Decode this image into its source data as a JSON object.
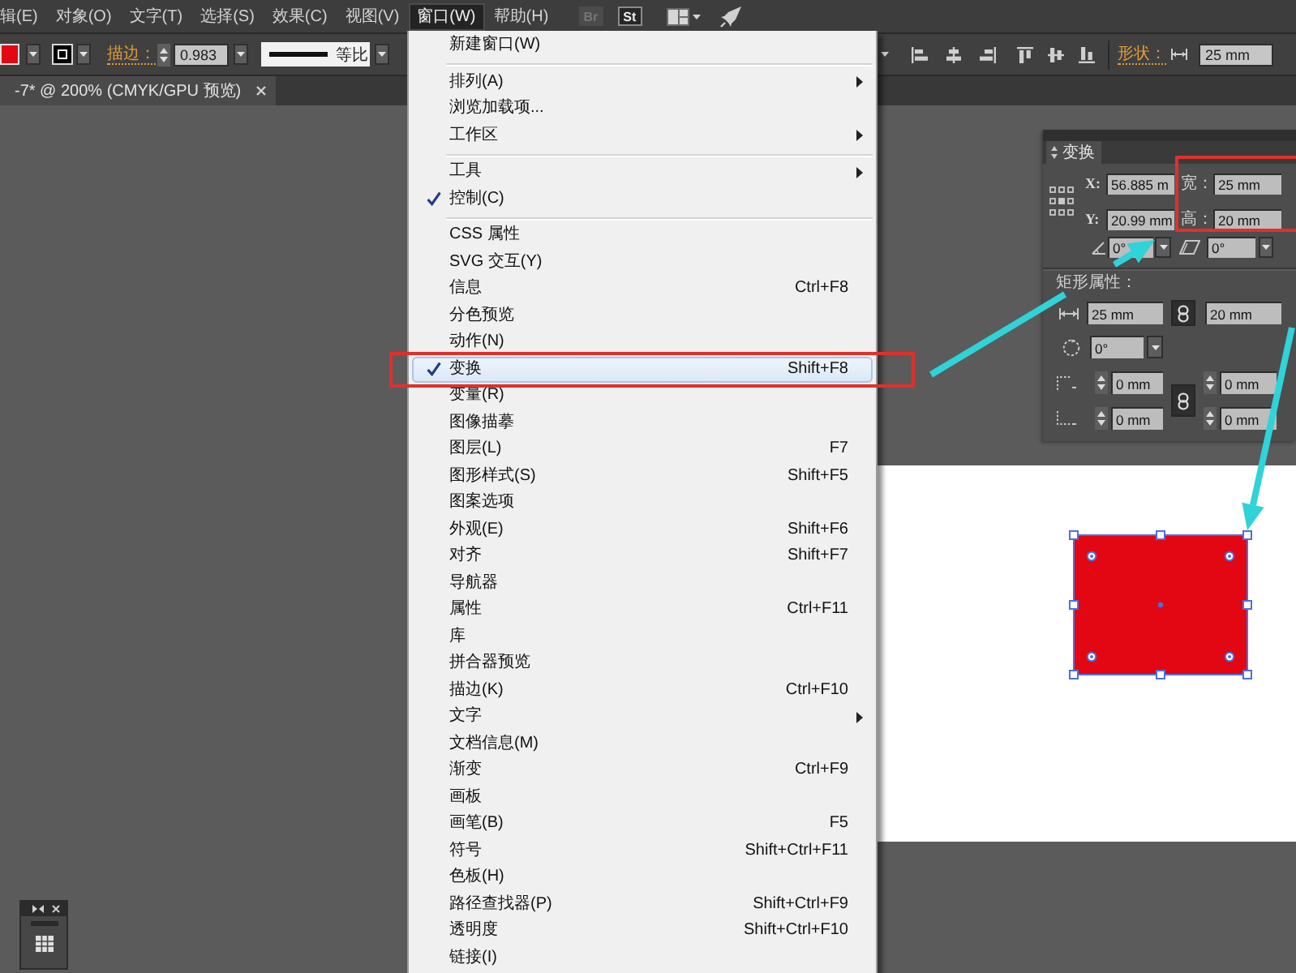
{
  "menubar": {
    "items": [
      {
        "label": "辑(E)",
        "selected": false
      },
      {
        "label": "对象(O)",
        "selected": false
      },
      {
        "label": "文字(T)",
        "selected": false
      },
      {
        "label": "选择(S)",
        "selected": false
      },
      {
        "label": "效果(C)",
        "selected": false
      },
      {
        "label": "视图(V)",
        "selected": false
      },
      {
        "label": "窗口(W)",
        "selected": true
      },
      {
        "label": "帮助(H)",
        "selected": false
      }
    ],
    "app_buttons": [
      {
        "label": "Br",
        "disabled": true
      },
      {
        "label": "St",
        "disabled": false
      }
    ]
  },
  "control_bar": {
    "swatches": [
      {
        "kind": "fill",
        "color": "#e30613"
      },
      {
        "kind": "stroke",
        "color": "#000000"
      }
    ],
    "stroke_label": "描边：",
    "stroke_weight": "0.983",
    "stroke_profile": "等比",
    "shape_label": "形状：",
    "shape_width": "25 mm"
  },
  "document_tab": {
    "title": "-7* @ 200% (CMYK/GPU 预览)"
  },
  "window_menu": {
    "groups": [
      {
        "items": [
          {
            "label": "新建窗口(W)",
            "checked": false,
            "submenu": false,
            "selected": false
          }
        ]
      },
      {
        "items": [
          {
            "label": "排列(A)",
            "checked": false,
            "submenu": true,
            "selected": false
          },
          {
            "label": "浏览加载项...",
            "checked": false,
            "submenu": false,
            "selected": false
          },
          {
            "label": "工作区",
            "checked": false,
            "submenu": true,
            "selected": false
          }
        ]
      },
      {
        "items": [
          {
            "label": "工具",
            "checked": false,
            "submenu": true,
            "selected": false
          },
          {
            "label": "控制(C)",
            "checked": true,
            "submenu": false,
            "selected": false
          }
        ]
      },
      {
        "items": [
          {
            "label": "CSS 属性",
            "checked": false,
            "submenu": false,
            "selected": false
          },
          {
            "label": "SVG 交互(Y)",
            "checked": false,
            "submenu": false,
            "selected": false
          },
          {
            "label": "信息",
            "shortcut": "Ctrl+F8",
            "checked": false,
            "submenu": false,
            "selected": false
          },
          {
            "label": "分色预览",
            "checked": false,
            "submenu": false,
            "selected": false
          },
          {
            "label": "动作(N)",
            "checked": false,
            "submenu": false,
            "selected": false
          },
          {
            "label": "变换",
            "shortcut": "Shift+F8",
            "checked": true,
            "submenu": false,
            "selected": true
          },
          {
            "label": "变量(R)",
            "checked": false,
            "submenu": false,
            "selected": false
          },
          {
            "label": "图像描摹",
            "checked": false,
            "submenu": false,
            "selected": false
          },
          {
            "label": "图层(L)",
            "shortcut": "F7",
            "checked": false,
            "submenu": false,
            "selected": false
          },
          {
            "label": "图形样式(S)",
            "shortcut": "Shift+F5",
            "checked": false,
            "submenu": false,
            "selected": false
          },
          {
            "label": "图案选项",
            "checked": false,
            "submenu": false,
            "selected": false
          },
          {
            "label": "外观(E)",
            "shortcut": "Shift+F6",
            "checked": false,
            "submenu": false,
            "selected": false
          },
          {
            "label": "对齐",
            "shortcut": "Shift+F7",
            "checked": false,
            "submenu": false,
            "selected": false
          },
          {
            "label": "导航器",
            "checked": false,
            "submenu": false,
            "selected": false
          },
          {
            "label": "属性",
            "shortcut": "Ctrl+F11",
            "checked": false,
            "submenu": false,
            "selected": false
          },
          {
            "label": "库",
            "checked": false,
            "submenu": false,
            "selected": false
          },
          {
            "label": "拼合器预览",
            "checked": false,
            "submenu": false,
            "selected": false
          },
          {
            "label": "描边(K)",
            "shortcut": "Ctrl+F10",
            "checked": false,
            "submenu": false,
            "selected": false
          },
          {
            "label": "文字",
            "checked": false,
            "submenu": true,
            "selected": false
          },
          {
            "label": "文档信息(M)",
            "checked": false,
            "submenu": false,
            "selected": false
          },
          {
            "label": "渐变",
            "shortcut": "Ctrl+F9",
            "checked": false,
            "submenu": false,
            "selected": false
          },
          {
            "label": "画板",
            "checked": false,
            "submenu": false,
            "selected": false
          },
          {
            "label": "画笔(B)",
            "shortcut": "F5",
            "checked": false,
            "submenu": false,
            "selected": false
          },
          {
            "label": "符号",
            "shortcut": "Shift+Ctrl+F11",
            "checked": false,
            "submenu": false,
            "selected": false
          },
          {
            "label": "色板(H)",
            "checked": false,
            "submenu": false,
            "selected": false
          },
          {
            "label": "路径查找器(P)",
            "shortcut": "Shift+Ctrl+F9",
            "checked": false,
            "submenu": false,
            "selected": false
          },
          {
            "label": "透明度",
            "shortcut": "Shift+Ctrl+F10",
            "checked": false,
            "submenu": false,
            "selected": false
          },
          {
            "label": "链接(I)",
            "checked": false,
            "submenu": false,
            "selected": false
          }
        ]
      }
    ]
  },
  "transform_panel": {
    "tab": "变换",
    "x_label": "X:",
    "x": "56.885 m",
    "width_label": "宽：",
    "width": "25 mm",
    "y_label": "Y:",
    "y": "20.99 mm",
    "height_label": "高：",
    "height": "20 mm",
    "angle": "0°",
    "shear": "0°",
    "section_title": "矩形属性：",
    "rect_width": "25 mm",
    "rect_height": "20 mm",
    "rect_rotation": "0°",
    "corner_radii": [
      "0 mm",
      "0 mm",
      "0 mm",
      "0 mm"
    ]
  }
}
